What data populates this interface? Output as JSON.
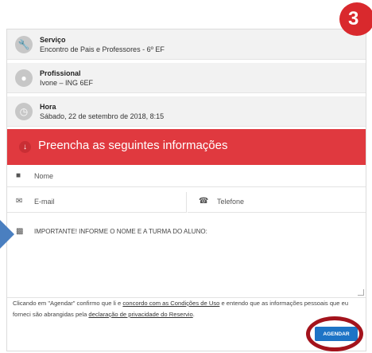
{
  "step_badge": "3",
  "info": [
    {
      "title": "Serviço",
      "value": "Encontro de Pais e Professores - 6º EF",
      "icon": "wrench-icon"
    },
    {
      "title": "Profissional",
      "value": "Ivone  – ING 6EF",
      "icon": "person-icon"
    },
    {
      "title": "Hora",
      "value": "Sábado, 22 de setembro de 2018, 8:15",
      "icon": "clock-icon"
    }
  ],
  "banner": {
    "text": "Preencha as seguintes informações",
    "color": "#e0393f"
  },
  "form": {
    "name_label": "Nome",
    "email_label": "E-mail",
    "phone_label": "Telefone",
    "notes_text": "IMPORTANTE! INFORME O NOME E A TURMA DO ALUNO:"
  },
  "terms": {
    "part1": "Clicando em \"Agendar\" confirmo que li e ",
    "link1": "concordo com as Condições de Uso",
    "part2": " e entendo que as informações pessoais que eu forneci são abrangidas pela ",
    "link2": "declaração de privacidade do Reservio",
    "part3": "."
  },
  "submit_label": "AGENDAR",
  "colors": {
    "accent": "#1e74c6",
    "highlight": "#a3131c"
  }
}
